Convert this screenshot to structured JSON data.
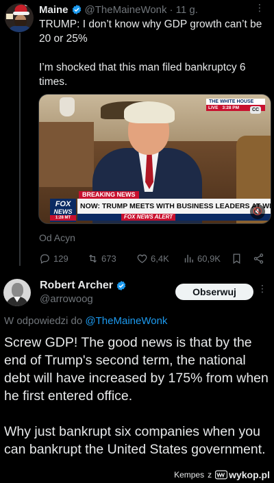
{
  "tweet": {
    "author_name": "Maine",
    "author_handle": "@TheMaineWonk",
    "time": "· 11 g.",
    "paragraphs": [
      "TRUMP: I don’t know why GDP growth can’t be 20 or 25%",
      "I’m shocked that this man filed bankruptcy 6 times."
    ],
    "video": {
      "white_house_label": "THE WHITE HOUSE",
      "live_label": "LIVE",
      "live_time": "3:28 PM",
      "cc_label": "CC",
      "breaking_label": "BREAKING NEWS",
      "headline": "NOW: TRUMP MEETS WITH BUSINESS LEADERS AT WH",
      "channel_top": "FOX",
      "channel_bottom": "NEWS",
      "channel_time": "1:28 MT",
      "alert_label": "FOX NEWS ALERT"
    },
    "source": "Od Acyn",
    "stats": {
      "replies": "129",
      "reposts": "673",
      "likes": "6,4K",
      "views": "60,9K"
    }
  },
  "reply": {
    "author_name": "Robert Archer",
    "author_handle": "@arrowoog",
    "follow_label": "Obserwuj",
    "replying_prefix": "W odpowiedzi do ",
    "replying_handle": "@TheMaineWonk",
    "paragraphs": [
      "Screw GDP! The good news is that by the end of Trump's second term, the national debt will have increased by 175% from when he first entered office.",
      "Why just bankrupt six companies when you can bankrupt the United States government."
    ]
  },
  "watermark": {
    "user": "Kempes",
    "z": "z",
    "site": "wykop.pl"
  },
  "colors": {
    "background": "#000000",
    "text": "#e7e9ea",
    "muted": "#71767b",
    "link": "#1d9bf0",
    "verified": "#1d9bf0"
  },
  "icons": [
    "verified-badge-icon",
    "more-icon",
    "reply-icon",
    "repost-icon",
    "like-icon",
    "views-icon",
    "bookmark-icon",
    "share-icon",
    "mute-icon",
    "wykop-logo-icon"
  ]
}
